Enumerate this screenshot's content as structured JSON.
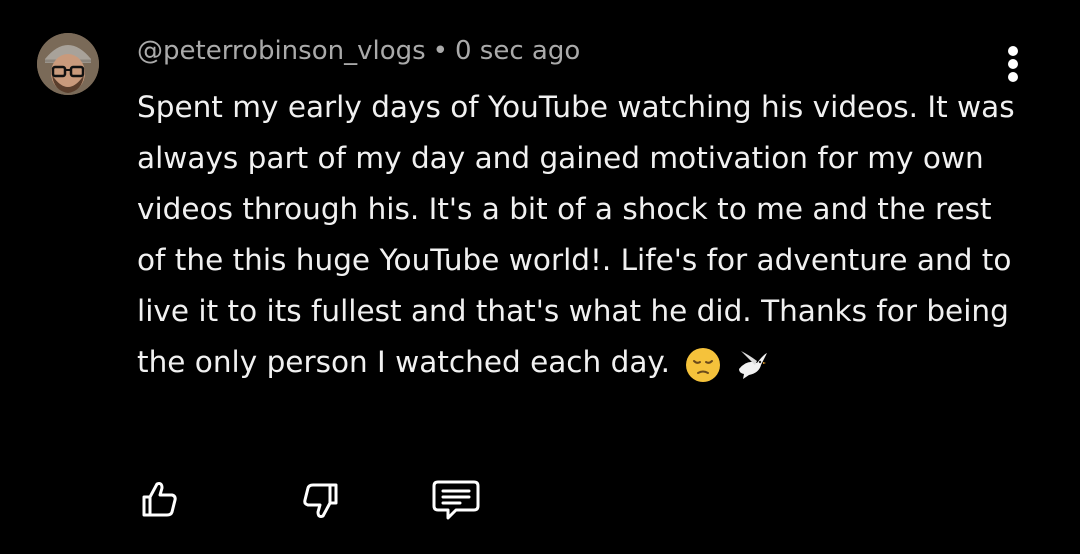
{
  "comment": {
    "author": "@peterrobinson_vlogs",
    "separator": "•",
    "timestamp": "0 sec ago",
    "text": "Spent my early days of YouTube watching his videos. It was always part of my day and gained motivation for my own videos through his. It's a bit of a shock to me and the rest of the this huge YouTube world!. Life's for adventure and to live it to its fullest and that's what he did. Thanks for being the only person I watched each day.",
    "emojis": [
      "pensive-face-emoji",
      "dove-emoji"
    ]
  },
  "icons": {
    "menu": "more-vertical-icon",
    "like": "thumbs-up-icon",
    "dislike": "thumbs-down-icon",
    "reply": "reply-comment-icon"
  },
  "colors": {
    "background": "#000000",
    "text": "#f1f1f1",
    "meta": "#aaaaaa",
    "emoji_face": "#f5c23b"
  }
}
